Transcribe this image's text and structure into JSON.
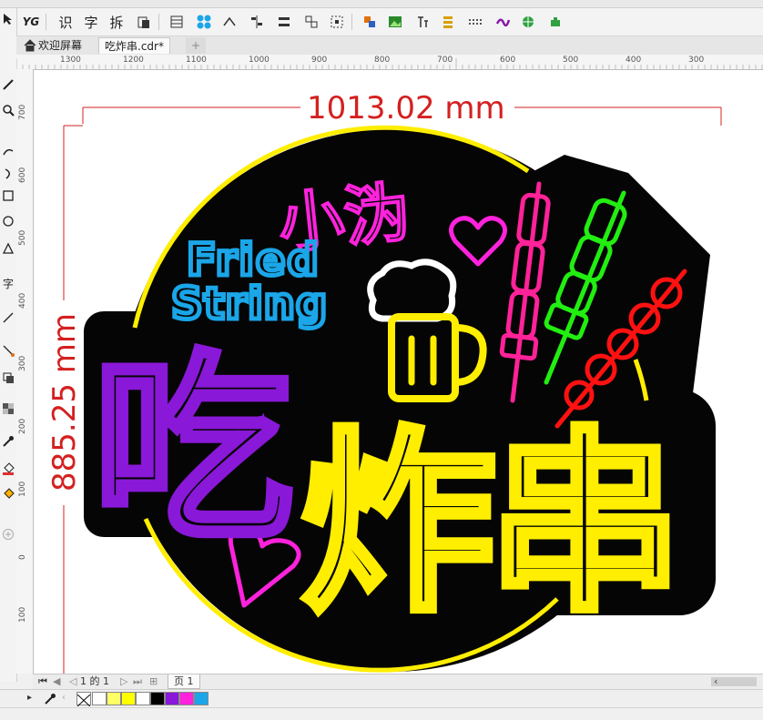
{
  "tabs": [
    {
      "label": "欢迎屏幕",
      "active": false
    },
    {
      "label": "吃炸串.cdr*",
      "active": true
    },
    {
      "label": "+"
    }
  ],
  "toolbar": {
    "icons": [
      "YG",
      "识",
      "字",
      "拆"
    ]
  },
  "ruler": {
    "h_labels": [
      "1300",
      "1200",
      "1100",
      "1000",
      "900",
      "800",
      "700",
      "600",
      "500",
      "400",
      "300"
    ],
    "v_labels": [
      "700",
      "600",
      "500",
      "400",
      "300",
      "200",
      "100",
      "0",
      "100"
    ]
  },
  "dimensions": {
    "width_label": "1013.02 mm",
    "height_label": "885.25 mm"
  },
  "artwork": {
    "title_cn": "小沩",
    "english_line1": "Fried",
    "english_line2": "String",
    "main_char1": "吃",
    "main_chars": "炸串",
    "colors": {
      "yellow": "#ffee00",
      "magenta": "#ff22dd",
      "cyan": "#1aa6e8",
      "purple": "#8a18d8",
      "green": "#22ee11",
      "red": "#ff1111",
      "pink": "#ff2299",
      "dimension_red": "#d42020"
    }
  },
  "pagebar": {
    "page_count": "1 的 1",
    "page_tab": "页 1"
  },
  "palette": {
    "swatches": [
      "#ffffff",
      "#ffff66",
      "#ffff00",
      "#ffffff",
      "#000000",
      "#8a18d8",
      "#ff22dd",
      "#1aa6e8"
    ]
  }
}
